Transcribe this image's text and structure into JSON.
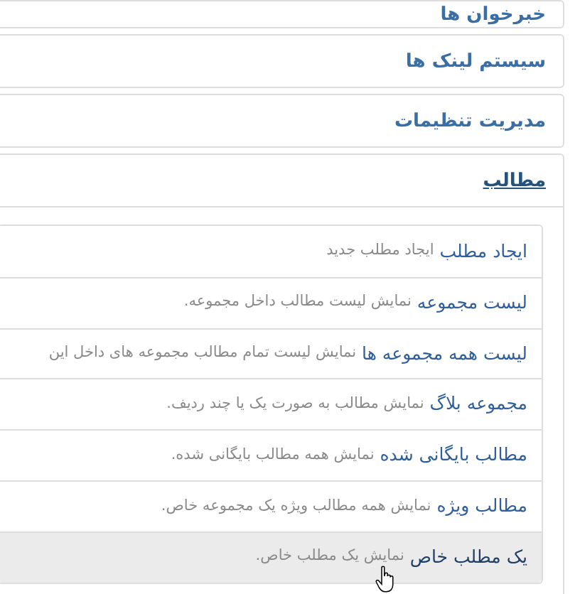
{
  "panels": [
    {
      "title": "خبرخوان ها",
      "expanded": false
    },
    {
      "title": "سیستم لینک ها",
      "expanded": false
    },
    {
      "title": "مدیریت تنظیمات",
      "expanded": false
    },
    {
      "title": "مطالب",
      "expanded": true,
      "items": [
        {
          "label": "ایجاد مطلب",
          "description": "ایجاد مطلب جدید",
          "selected": false
        },
        {
          "label": "لیست مجموعه",
          "description": "نمایش لیست مطالب داخل مجموعه.",
          "selected": false
        },
        {
          "label": "لیست همه مجموعه ها",
          "description": "نمایش لیست تمام مطالب مجموعه های داخل این",
          "selected": false
        },
        {
          "label": "مجموعه بلاگ",
          "description": "نمایش مطالب به صورت یک یا چند ردیف.",
          "selected": false
        },
        {
          "label": "مطالب بایگانی شده",
          "description": "نمایش همه مطالب بایگانی شده.",
          "selected": false
        },
        {
          "label": "مطالب ویژه",
          "description": "نمایش همه مطالب ویژه یک مجموعه خاص.",
          "selected": false
        },
        {
          "label": "یک مطلب خاص",
          "description": "نمایش یک مطلب خاص.",
          "selected": true
        }
      ]
    }
  ]
}
